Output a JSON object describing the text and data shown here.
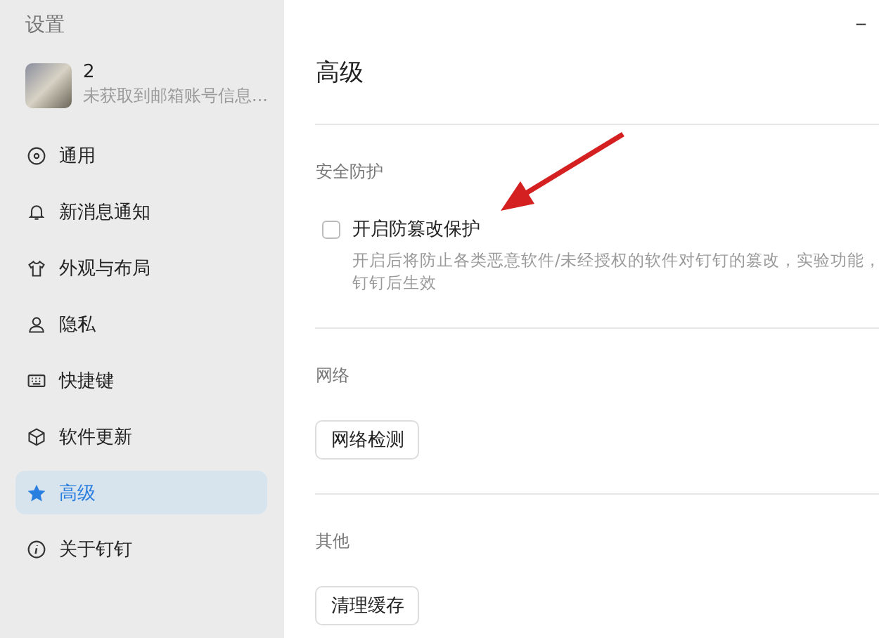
{
  "sidebar": {
    "title": "设置",
    "profile": {
      "name": "2",
      "subtitle": "未获取到邮箱账号信息..."
    },
    "items": [
      {
        "label": "通用",
        "selected": false
      },
      {
        "label": "新消息通知",
        "selected": false
      },
      {
        "label": "外观与布局",
        "selected": false
      },
      {
        "label": "隐私",
        "selected": false
      },
      {
        "label": "快捷键",
        "selected": false
      },
      {
        "label": "软件更新",
        "selected": false
      },
      {
        "label": "高级",
        "selected": true
      },
      {
        "label": "关于钉钉",
        "selected": false
      }
    ]
  },
  "window": {
    "minimize": "−"
  },
  "page": {
    "title": "高级",
    "sections": [
      {
        "heading": "安全防护",
        "kind": "checkbox",
        "label": "开启防篡改保护",
        "checked": false,
        "description": [
          "开启后将防止各类恶意软件/未经授权的软件对钉钉的篡改，实验功能，",
          "钉钉后生效"
        ]
      },
      {
        "heading": "网络",
        "kind": "button",
        "button": "网络检测"
      },
      {
        "heading": "其他",
        "kind": "button",
        "button": "清理缓存"
      }
    ]
  }
}
